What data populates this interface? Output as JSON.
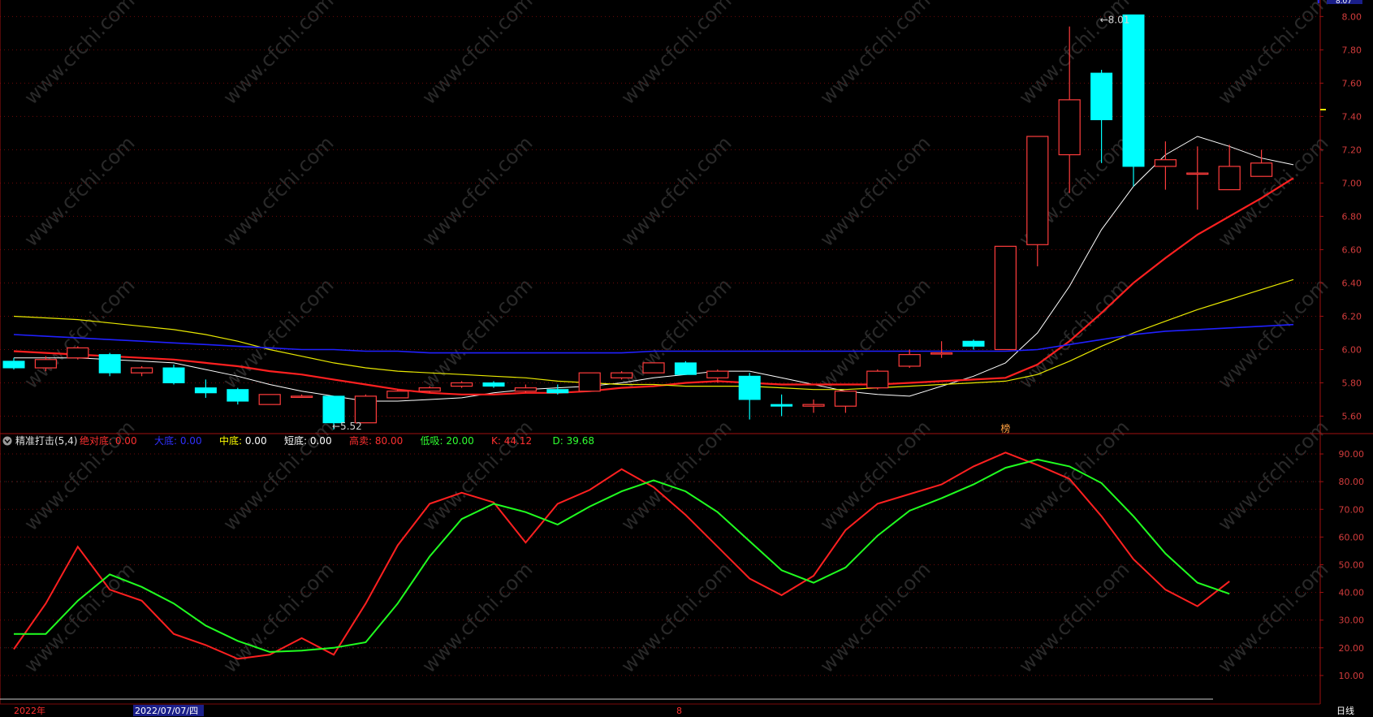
{
  "colors": {
    "bg": "#000000",
    "grid": "#6e0a0a",
    "up": "#ff3c3c",
    "down": "#00ffff",
    "ma5": "#ffffff",
    "ma10": "#ff2020",
    "ma20": "#e8e800",
    "ma60": "#2020ff",
    "k": "#ff2020",
    "d": "#20ff20",
    "axis_text": "#d23c3c",
    "watermark": "#5a5a5a"
  },
  "watermark": "www.cfchi.com",
  "status_bar": {
    "year_label": "2022年",
    "date_label": "2022/07/07/四",
    "month_label": "8",
    "period_label": "日线"
  },
  "indicator_header": {
    "name": "精准打击(5,4)",
    "items": [
      {
        "label": "绝对底:",
        "value": "0.00",
        "color": "#ff3030"
      },
      {
        "label": "大底:",
        "value": "0.00",
        "color": "#3030ff"
      },
      {
        "label": "中底:",
        "value": "0.00",
        "color": "#ffff00"
      },
      {
        "label": "短底:",
        "value": "0.00",
        "color": "#ffffff"
      },
      {
        "label": "高卖:",
        "value": "80.00",
        "color": "#ff3030"
      },
      {
        "label": "低吸:",
        "value": "20.00",
        "color": "#30ff30"
      },
      {
        "label": "K:",
        "value": "44.12",
        "color": "#ff3030"
      },
      {
        "label": "D:",
        "value": "39.68",
        "color": "#30ff30"
      }
    ]
  },
  "top_price_label": "8.07",
  "chart_data": [
    {
      "type": "candlestick",
      "ylim": [
        5.5,
        8.07
      ],
      "yticks": [
        "5.60",
        "5.80",
        "6.00",
        "6.20",
        "6.40",
        "6.60",
        "6.80",
        "7.00",
        "7.20",
        "7.40",
        "7.60",
        "7.80",
        "8.00"
      ],
      "annotations": [
        {
          "text": "←5.52",
          "x": 10,
          "y": 5.52
        },
        {
          "text": "←8.01",
          "x": 34,
          "y": 8.01
        },
        {
          "text": "榜",
          "x": 31,
          "y": 5.55
        }
      ],
      "candles": [
        {
          "o": 5.93,
          "h": 5.95,
          "l": 5.88,
          "c": 5.89
        },
        {
          "o": 5.89,
          "h": 5.96,
          "l": 5.87,
          "c": 5.94
        },
        {
          "o": 5.95,
          "h": 6.02,
          "l": 5.94,
          "c": 6.01
        },
        {
          "o": 5.97,
          "h": 5.98,
          "l": 5.84,
          "c": 5.86
        },
        {
          "o": 5.86,
          "h": 5.9,
          "l": 5.84,
          "c": 5.89
        },
        {
          "o": 5.89,
          "h": 5.91,
          "l": 5.79,
          "c": 5.8
        },
        {
          "o": 5.77,
          "h": 5.82,
          "l": 5.71,
          "c": 5.74
        },
        {
          "o": 5.76,
          "h": 5.77,
          "l": 5.67,
          "c": 5.69
        },
        {
          "o": 5.67,
          "h": 5.73,
          "l": 5.67,
          "c": 5.73
        },
        {
          "o": 5.72,
          "h": 5.73,
          "l": 5.71,
          "c": 5.72
        },
        {
          "o": 5.72,
          "h": 5.72,
          "l": 5.52,
          "c": 5.56
        },
        {
          "o": 5.56,
          "h": 5.73,
          "l": 5.56,
          "c": 5.72
        },
        {
          "o": 5.71,
          "h": 5.76,
          "l": 5.71,
          "c": 5.75
        },
        {
          "o": 5.75,
          "h": 5.78,
          "l": 5.74,
          "c": 5.77
        },
        {
          "o": 5.78,
          "h": 5.81,
          "l": 5.77,
          "c": 5.8
        },
        {
          "o": 5.8,
          "h": 5.81,
          "l": 5.77,
          "c": 5.78
        },
        {
          "o": 5.75,
          "h": 5.79,
          "l": 5.74,
          "c": 5.77
        },
        {
          "o": 5.76,
          "h": 5.79,
          "l": 5.73,
          "c": 5.74
        },
        {
          "o": 5.75,
          "h": 5.86,
          "l": 5.75,
          "c": 5.86
        },
        {
          "o": 5.83,
          "h": 5.87,
          "l": 5.82,
          "c": 5.86
        },
        {
          "o": 5.86,
          "h": 5.92,
          "l": 5.86,
          "c": 5.92
        },
        {
          "o": 5.92,
          "h": 5.93,
          "l": 5.85,
          "c": 5.85
        },
        {
          "o": 5.83,
          "h": 5.88,
          "l": 5.8,
          "c": 5.87
        },
        {
          "o": 5.84,
          "h": 5.86,
          "l": 5.58,
          "c": 5.7
        },
        {
          "o": 5.67,
          "h": 5.73,
          "l": 5.6,
          "c": 5.66
        },
        {
          "o": 5.66,
          "h": 5.7,
          "l": 5.62,
          "c": 5.67
        },
        {
          "o": 5.66,
          "h": 5.75,
          "l": 5.62,
          "c": 5.75
        },
        {
          "o": 5.77,
          "h": 5.88,
          "l": 5.76,
          "c": 5.87
        },
        {
          "o": 5.9,
          "h": 6.0,
          "l": 5.89,
          "c": 5.97
        },
        {
          "o": 5.98,
          "h": 6.05,
          "l": 5.95,
          "c": 5.98
        },
        {
          "o": 6.05,
          "h": 6.06,
          "l": 6.0,
          "c": 6.02
        },
        {
          "o": 6.0,
          "h": 6.62,
          "l": 6.0,
          "c": 6.62
        },
        {
          "o": 6.63,
          "h": 7.28,
          "l": 6.5,
          "c": 7.28
        },
        {
          "o": 7.17,
          "h": 7.94,
          "l": 6.94,
          "c": 7.5
        },
        {
          "o": 7.66,
          "h": 7.68,
          "l": 7.12,
          "c": 7.38
        },
        {
          "o": 8.01,
          "h": 8.01,
          "l": 6.98,
          "c": 7.1
        },
        {
          "o": 7.1,
          "h": 7.25,
          "l": 6.96,
          "c": 7.14
        },
        {
          "o": 7.06,
          "h": 7.22,
          "l": 6.84,
          "c": 7.06
        },
        {
          "o": 6.96,
          "h": 7.23,
          "l": 6.96,
          "c": 7.1
        },
        {
          "o": 7.04,
          "h": 7.2,
          "l": 7.04,
          "c": 7.12
        }
      ],
      "series": [
        {
          "name": "MA5",
          "values": [
            5.95,
            5.95,
            5.95,
            5.94,
            5.93,
            5.92,
            5.88,
            5.84,
            5.79,
            5.75,
            5.72,
            5.69,
            5.69,
            5.7,
            5.71,
            5.74,
            5.76,
            5.77,
            5.78,
            5.8,
            5.83,
            5.85,
            5.87,
            5.87,
            5.83,
            5.79,
            5.75,
            5.73,
            5.72,
            5.78,
            5.84,
            5.92,
            6.1,
            6.38,
            6.72,
            6.98,
            7.17,
            7.28,
            7.22,
            7.15,
            7.11
          ]
        },
        {
          "name": "MA10",
          "values": [
            5.99,
            5.98,
            5.97,
            5.96,
            5.95,
            5.94,
            5.92,
            5.9,
            5.87,
            5.85,
            5.82,
            5.79,
            5.76,
            5.74,
            5.73,
            5.73,
            5.74,
            5.74,
            5.75,
            5.77,
            5.78,
            5.8,
            5.81,
            5.8,
            5.79,
            5.79,
            5.79,
            5.79,
            5.8,
            5.81,
            5.82,
            5.83,
            5.91,
            6.05,
            6.22,
            6.4,
            6.55,
            6.69,
            6.8,
            6.91,
            7.03
          ]
        },
        {
          "name": "MA20",
          "values": [
            6.2,
            6.19,
            6.18,
            6.16,
            6.14,
            6.12,
            6.09,
            6.05,
            6.0,
            5.96,
            5.92,
            5.89,
            5.87,
            5.86,
            5.85,
            5.84,
            5.83,
            5.81,
            5.8,
            5.79,
            5.79,
            5.78,
            5.78,
            5.78,
            5.77,
            5.76,
            5.76,
            5.77,
            5.78,
            5.79,
            5.8,
            5.81,
            5.85,
            5.93,
            6.02,
            6.1,
            6.17,
            6.24,
            6.3,
            6.36,
            6.42
          ]
        },
        {
          "name": "MA60",
          "values": [
            6.09,
            6.08,
            6.07,
            6.06,
            6.05,
            6.04,
            6.03,
            6.02,
            6.01,
            6.0,
            6.0,
            5.99,
            5.99,
            5.98,
            5.98,
            5.98,
            5.98,
            5.98,
            5.98,
            5.98,
            5.99,
            5.99,
            5.99,
            5.99,
            5.99,
            5.99,
            5.99,
            5.99,
            5.99,
            5.99,
            5.99,
            5.99,
            6.0,
            6.03,
            6.06,
            6.09,
            6.11,
            6.12,
            6.13,
            6.14,
            6.15
          ]
        }
      ]
    },
    {
      "type": "line",
      "title": "精准打击(5,4)",
      "ylim": [
        0,
        95
      ],
      "yticks": [
        "10.00",
        "20.00",
        "30.00",
        "40.00",
        "50.00",
        "60.00",
        "70.00",
        "80.00",
        "90.00"
      ],
      "series": [
        {
          "name": "K",
          "values": [
            19.5,
            36,
            56.5,
            41,
            37,
            25,
            21,
            16,
            17.5,
            23.5,
            17.5,
            36,
            57,
            72,
            76,
            72.5,
            58,
            72,
            77,
            84.5,
            78,
            68,
            56.5,
            45,
            39,
            46,
            62.5,
            72,
            75.5,
            79,
            85.5,
            90.5,
            86,
            81,
            67.5,
            52,
            41,
            35,
            44
          ]
        },
        {
          "name": "D",
          "values": [
            25,
            25,
            37,
            46.5,
            42,
            36,
            28,
            22.5,
            18.5,
            19,
            20,
            22,
            36,
            53,
            66.5,
            72,
            69,
            64.5,
            71,
            76.5,
            80.5,
            76.5,
            69,
            58.5,
            48,
            43.5,
            49,
            60.5,
            69.5,
            74,
            79,
            85,
            88,
            85.5,
            79.5,
            67.5,
            54,
            43.5,
            39.5
          ]
        }
      ]
    }
  ]
}
